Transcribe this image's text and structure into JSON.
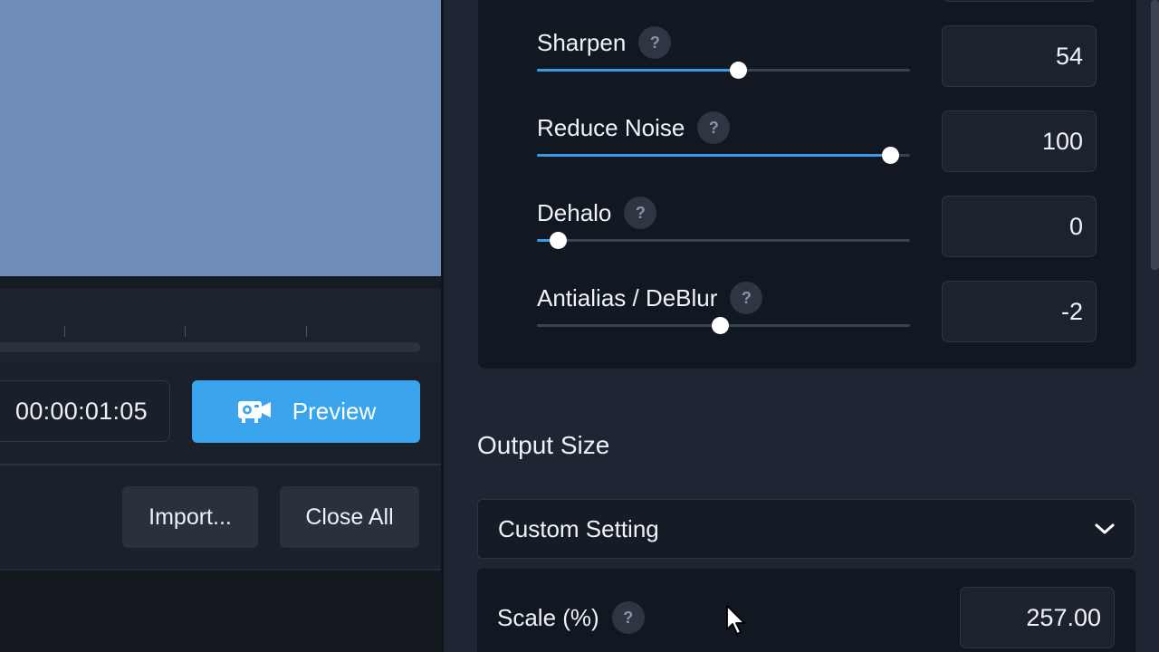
{
  "left": {
    "time_display": "00:00:01:05",
    "preview_label": "Preview",
    "import_label": "Import...",
    "close_all_label": "Close All"
  },
  "enhance": {
    "sliders": [
      {
        "label": "Sharpen",
        "value": "54",
        "level": 0.54
      },
      {
        "label": "Reduce Noise",
        "value": "100",
        "level": 0.946
      },
      {
        "label": "Dehalo",
        "value": "0",
        "level": 0.055
      },
      {
        "label": "Antialias / DeBlur",
        "value": "-2",
        "level": 0.49
      }
    ],
    "help_glyph": "?"
  },
  "output": {
    "section_title": "Output Size",
    "select_value": "Custom Setting",
    "scale_label": "Scale (%)",
    "scale_value": "257.00"
  },
  "icons": {
    "preview": "projector-icon",
    "select": "chevron-down-icon",
    "help": "help-icon",
    "cursor": "mouse-pointer-icon"
  },
  "colors": {
    "accent": "#3aa4ee",
    "slider_fill": "#3b9be8",
    "video_area": "#6f8db9"
  }
}
